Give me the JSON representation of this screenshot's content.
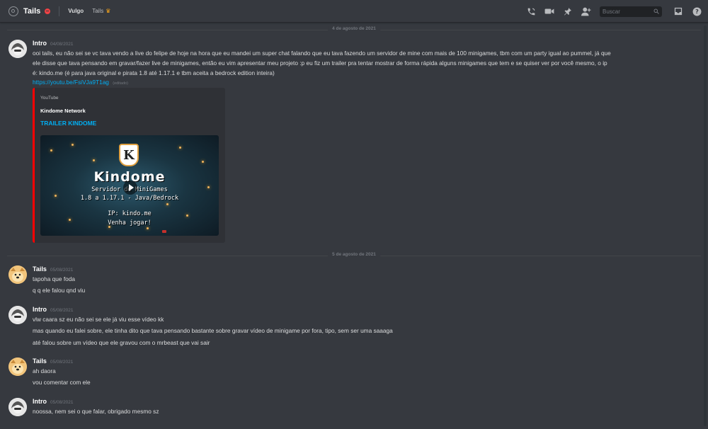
{
  "header": {
    "channel_name": "Tails",
    "nicknames": [
      "Vulgo",
      "Tails"
    ],
    "crown_icon": "crown-icon",
    "search_placeholder": "Buscar"
  },
  "dividers": [
    "4 de agosto de 2021",
    "5 de agosto de 2021"
  ],
  "messages": [
    {
      "author": "Intro",
      "timestamp": "04/08/2021",
      "lines": [
        "ooi tails, eu não sei se vc tava vendo a live do felipe de hoje na hora que eu mandei um super chat falando que eu tava fazendo um servidor de mine com mais de 100 minigames, tbm com um party igual ao pummel, já que",
        "ele disse que tava pensando em gravar/fazer live de minigames, então eu vim apresentar meu projeto :p eu fiz um trailer pra tentar mostrar de forma rápida alguns minigames que tem e se quiser ver por você mesmo, o ip",
        "é: kindo.me (é para java original e pirata 1.8 até 1.17.1 e tbm aceita a bedrock edition inteira)"
      ],
      "link": "https://youtu.be/FsiVJa9T1ag",
      "edited": "(editado)",
      "embed": {
        "provider": "YouTube",
        "author": "Kindome Network",
        "title": "TRAILER KINDOME",
        "thumbnail": {
          "logo_letter": "K",
          "big": "Kindome",
          "subtitle": "Servidor de MiniGames",
          "versions": "1.8 a 1.17.1 - Java/Bedrock",
          "ip": "IP: kindo.me",
          "join": "Venha jogar!"
        }
      }
    },
    {
      "author": "Tails",
      "timestamp": "05/08/2021",
      "lines": [
        "tapoha que foda",
        "q q ele falou qnd viu"
      ]
    },
    {
      "author": "Intro",
      "timestamp": "05/08/2021",
      "lines": [
        "vlw caara sz eu não sei se ele já viu esse vídeo kk",
        "mas quando eu falei sobre, ele tinha dito que tava pensando bastante sobre gravar vídeo de minigame por fora, tipo, sem ser uma saaaga",
        "até falou sobre um vídeo que ele gravou com o mrbeast que vai sair"
      ]
    },
    {
      "author": "Tails",
      "timestamp": "05/08/2021",
      "lines": [
        "ah daora",
        "vou comentar com ele"
      ]
    },
    {
      "author": "Intro",
      "timestamp": "05/08/2021",
      "lines": [
        "noossa, nem sei o que falar, obrigado mesmo sz"
      ]
    }
  ]
}
